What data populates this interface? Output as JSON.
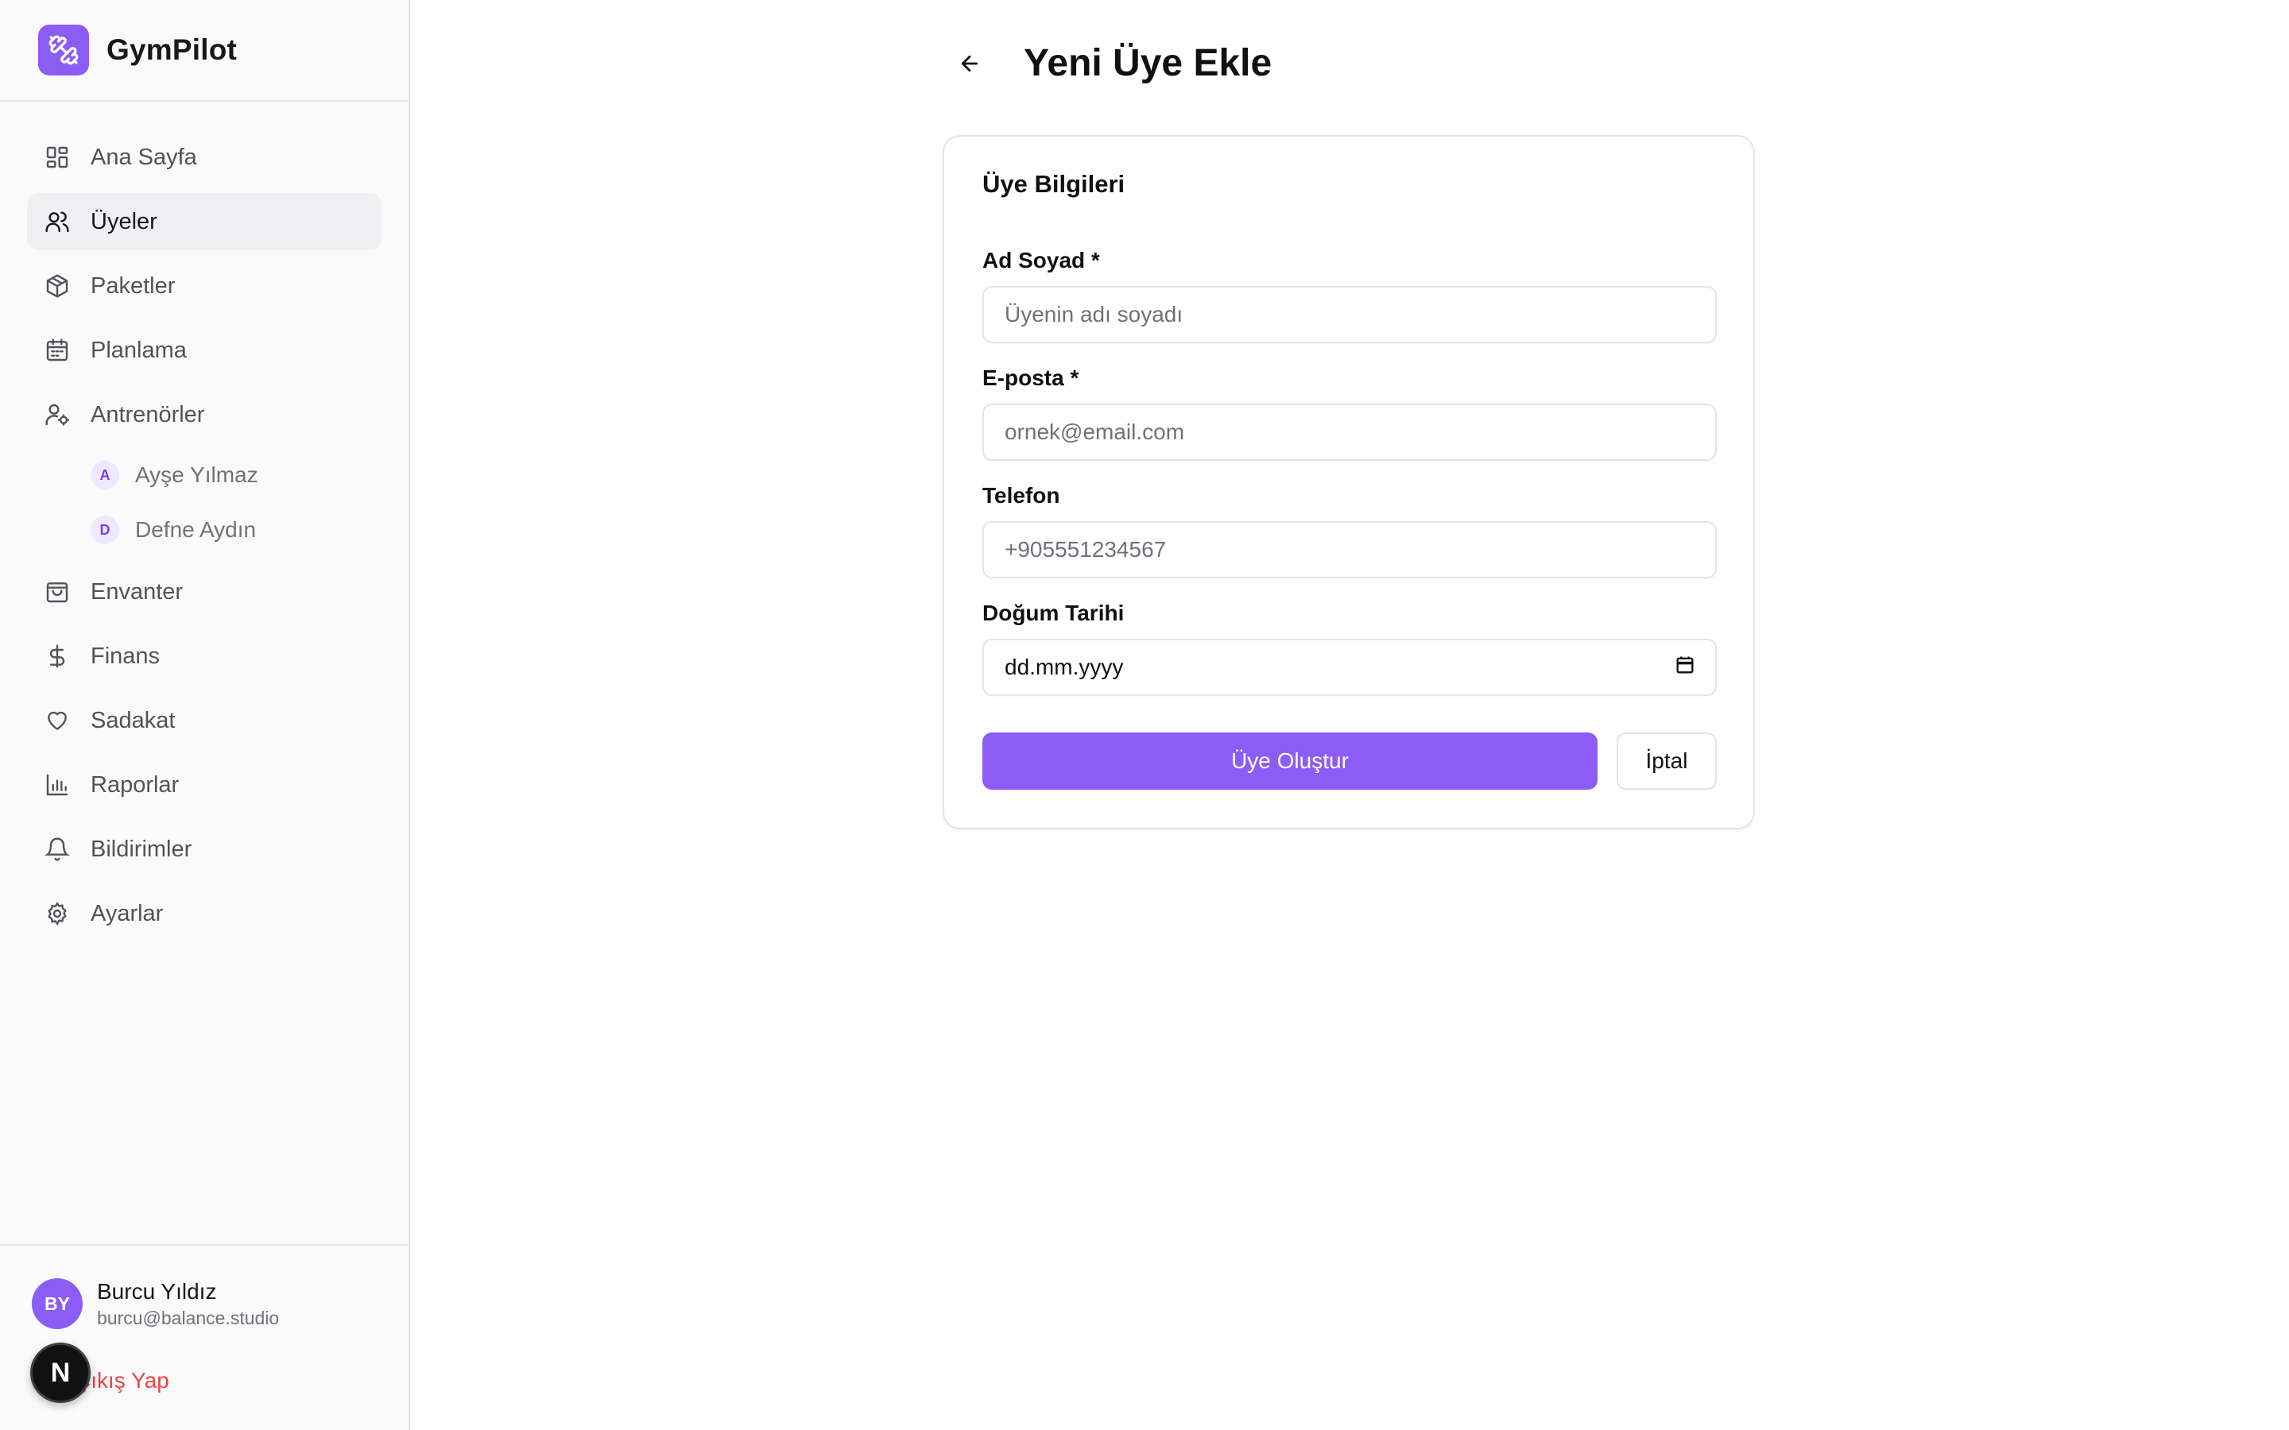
{
  "app": {
    "name": "GymPilot",
    "accent": "#8b5cf6"
  },
  "sidebar": {
    "items": [
      {
        "label": "Ana Sayfa",
        "icon": "layout-grid-icon"
      },
      {
        "label": "Üyeler",
        "icon": "users-icon",
        "active": true
      },
      {
        "label": "Paketler",
        "icon": "package-icon"
      },
      {
        "label": "Planlama",
        "icon": "calendar-icon"
      },
      {
        "label": "Antrenörler",
        "icon": "user-cog-icon"
      },
      {
        "label": "Envanter",
        "icon": "shopping-bag-icon"
      },
      {
        "label": "Finans",
        "icon": "dollar-icon"
      },
      {
        "label": "Sadakat",
        "icon": "heart-icon"
      },
      {
        "label": "Raporlar",
        "icon": "bar-chart-icon"
      },
      {
        "label": "Bildirimler",
        "icon": "bell-icon"
      },
      {
        "label": "Ayarlar",
        "icon": "gear-icon"
      }
    ],
    "trainers": [
      {
        "initial": "A",
        "name": "Ayşe Yılmaz"
      },
      {
        "initial": "D",
        "name": "Defne Aydın"
      }
    ]
  },
  "user": {
    "initials": "BY",
    "name": "Burcu Yıldız",
    "email": "burcu@balance.studio",
    "logout_label": "Çıkış Yap",
    "dev_badge": "N"
  },
  "page": {
    "title": "Yeni Üye Ekle"
  },
  "form": {
    "title": "Üye Bilgileri",
    "fields": [
      {
        "label": "Ad Soyad *",
        "placeholder": "Üyenin adı soyadı"
      },
      {
        "label": "E-posta *",
        "placeholder": "ornek@email.com"
      },
      {
        "label": "Telefon",
        "placeholder": "+905551234567"
      },
      {
        "label": "Doğum Tarihi",
        "value": "dd.mm.yyyy"
      }
    ],
    "submit_label": "Üye Oluştur",
    "cancel_label": "İptal"
  }
}
